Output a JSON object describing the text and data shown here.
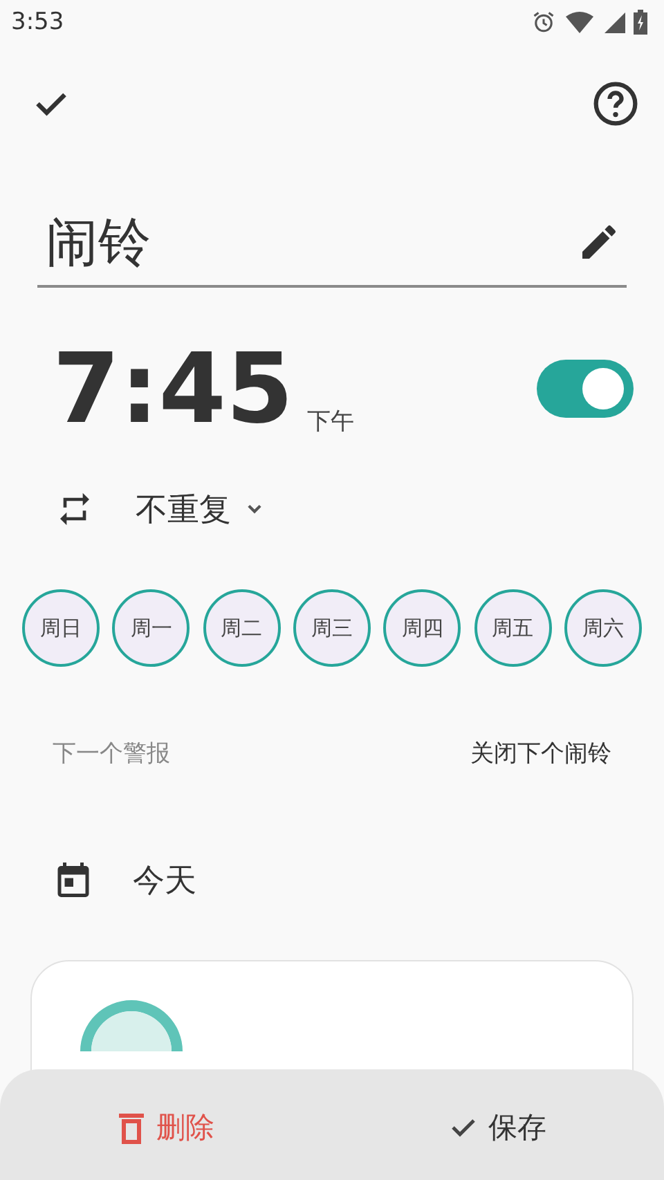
{
  "status_bar": {
    "time": "3:53"
  },
  "title_field": {
    "value": "闹铃"
  },
  "alarm": {
    "time": "7:45",
    "period": "下午",
    "on": true
  },
  "repeat": {
    "label": "不重复"
  },
  "days": [
    {
      "label": "周日",
      "selected": false
    },
    {
      "label": "周一",
      "selected": false
    },
    {
      "label": "周二",
      "selected": false
    },
    {
      "label": "周三",
      "selected": false
    },
    {
      "label": "周四",
      "selected": false
    },
    {
      "label": "周五",
      "selected": false
    },
    {
      "label": "周六",
      "selected": false
    }
  ],
  "next_alarm": {
    "label": "下一个警报",
    "action": "关闭下个闹铃"
  },
  "date": {
    "label": "今天"
  },
  "bottom_bar": {
    "delete": "删除",
    "save": "保存"
  }
}
